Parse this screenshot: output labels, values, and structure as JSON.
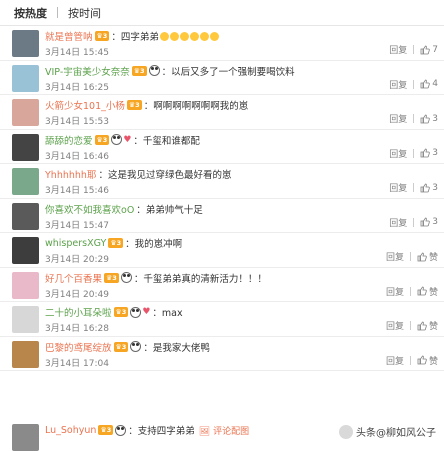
{
  "sort": {
    "hot": "按热度",
    "time": "按时间"
  },
  "comments": [
    {
      "name": "就是曾管呐",
      "badge": "3",
      "text": "：四字弟弟",
      "emojis": 6,
      "time": "3月14日 15:45",
      "reply": "回复",
      "likes": "7",
      "green": false,
      "avatar_color": "#6c7a86",
      "extra_icon": false
    },
    {
      "name": "VIP-宇宙美少女奈奈",
      "badge": "3",
      "text": "：以后又多了一个强制要喝饮料",
      "time": "3月14日 16:25",
      "reply": "回复",
      "likes": "4",
      "green": true,
      "avatar_color": "#9ac2d6",
      "extra_icon": true
    },
    {
      "name": "火箭少女101_小杨",
      "badge": "3",
      "text": "：啊啊啊啊啊啊啊我的崽",
      "time": "3月14日 15:53",
      "reply": "回复",
      "likes": "3",
      "green": false,
      "avatar_color": "#d8a69b",
      "extra_icon": false
    },
    {
      "name": "舔舔的恋爱",
      "badge": "3",
      "text": "：千玺和谁都配",
      "time": "3月14日 16:46",
      "reply": "回复",
      "likes": "3",
      "green": true,
      "avatar_color": "#444444",
      "extra_icon": true,
      "heart": true
    },
    {
      "name": "Yhhhhhh耶",
      "badge": "",
      "text": "：这是我见过穿绿色最好看的崽",
      "time": "3月14日 15:46",
      "reply": "回复",
      "likes": "3",
      "green": false,
      "name_plain": true,
      "avatar_color": "#7aa88a",
      "extra_icon": false
    },
    {
      "name": "你喜欢不如我喜欢oO",
      "badge": "",
      "text": "：弟弟帅气十足",
      "time": "3月14日 15:47",
      "reply": "回复",
      "likes": "3",
      "green": true,
      "avatar_color": "#5a5a5a",
      "extra_icon": false
    },
    {
      "name": "whispersXGY",
      "badge": "3",
      "text": "：我的崽冲啊",
      "time": "3月14日 20:29",
      "reply": "回复",
      "likes": "赞",
      "green": true,
      "avatar_color": "#3d3d3d",
      "extra_icon": false
    },
    {
      "name": "好几个百香果",
      "badge": "3",
      "text": "：千玺弟弟真的清新活力！！！",
      "time": "3月14日 20:49",
      "reply": "回复",
      "likes": "赞",
      "green": false,
      "avatar_color": "#e9b9c9",
      "extra_icon": true
    },
    {
      "name": "二十的小耳朵啦",
      "badge": "3",
      "text": "：max",
      "time": "3月14日 16:28",
      "reply": "回复",
      "likes": "赞",
      "green": true,
      "avatar_color": "#d7d7d7",
      "extra_icon": true,
      "heart": true
    },
    {
      "name": "巴黎的鸢尾绽放",
      "badge": "3",
      "text": "：是我家大佬鸭",
      "time": "3月14日 17:04",
      "reply": "回复",
      "likes": "赞",
      "green": false,
      "avatar_color": "#b8864b",
      "extra_icon": true
    }
  ],
  "last": {
    "name": "Lu_Sohyun",
    "badge": "3",
    "text": "：支持四字弟弟",
    "more": "评论配图"
  },
  "watermark": "头条@柳如风公子"
}
